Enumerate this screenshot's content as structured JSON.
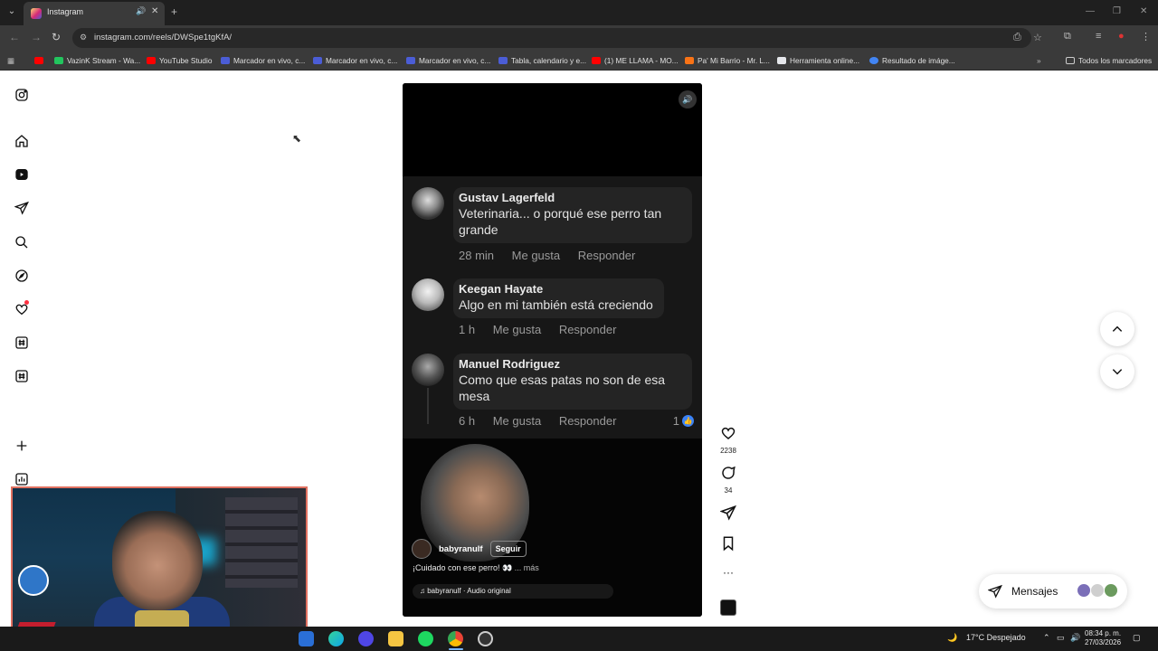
{
  "browser": {
    "tab_title": "Instagram",
    "url": "instagram.com/reels/DWSpe1tgKfA/",
    "bookmarks": [
      {
        "label": "VazinK Stream - Wa...",
        "color": "#22c55e"
      },
      {
        "label": "YouTube Studio",
        "color": "#ff0000"
      },
      {
        "label": "Marcador en vivo, c...",
        "color": "#4b5dd6"
      },
      {
        "label": "Marcador en vivo, c...",
        "color": "#4b5dd6"
      },
      {
        "label": "Marcador en vivo, c...",
        "color": "#4b5dd6"
      },
      {
        "label": "Tabla, calendario y e...",
        "color": "#4b5dd6"
      },
      {
        "label": "(1) ME LLAMA - MO...",
        "color": "#ff0000"
      },
      {
        "label": "Pa' Mi Barrio - Mr. L...",
        "color": "#f97316"
      },
      {
        "label": "Herramienta online...",
        "color": "#e5e7eb"
      },
      {
        "label": "Resultado de imáge...",
        "color": "#4285f4"
      }
    ],
    "all_bookmarks_label": "Todos los marcadores"
  },
  "sidebar": {
    "icons": [
      "instagram-logo-icon",
      "home-icon",
      "reels-icon",
      "send-icon",
      "search-icon",
      "explore-icon",
      "heart-icon",
      "hashtag-icon",
      "hashtag-icon",
      "plus-icon",
      "stats-icon"
    ]
  },
  "reel": {
    "comments": [
      {
        "name": "Gustav Lagerfeld",
        "text": "Veterinaria... o porqué ese perro tan grande",
        "time": "28 min",
        "like": "Me gusta",
        "reply": "Responder",
        "likes": ""
      },
      {
        "name": "Keegan Hayate",
        "text": "Algo en mi también está creciendo",
        "time": "1 h",
        "like": "Me gusta",
        "reply": "Responder",
        "likes": ""
      },
      {
        "name": "Manuel Rodriguez",
        "text": "Como que esas patas no son de esa mesa",
        "time": "6 h",
        "like": "Me gusta",
        "reply": "Responder",
        "likes": "1"
      }
    ],
    "author": "babyranulf",
    "follow_label": "Seguir",
    "caption": "¡Cuidado con ese perro! 👀",
    "more_label": "... más",
    "audio": "babyranulf · Audio original"
  },
  "actions": {
    "likes": "2238",
    "comments": "34"
  },
  "messages": {
    "label": "Mensajes"
  },
  "taskbar": {
    "weather": "17°C  Despejado",
    "time": "08:34 p. m.",
    "date": "27/03/2026"
  },
  "colors": {
    "accent_blue": "#3b82f6",
    "notification_red": "#ff3040",
    "webcam_border": "#e07060"
  }
}
